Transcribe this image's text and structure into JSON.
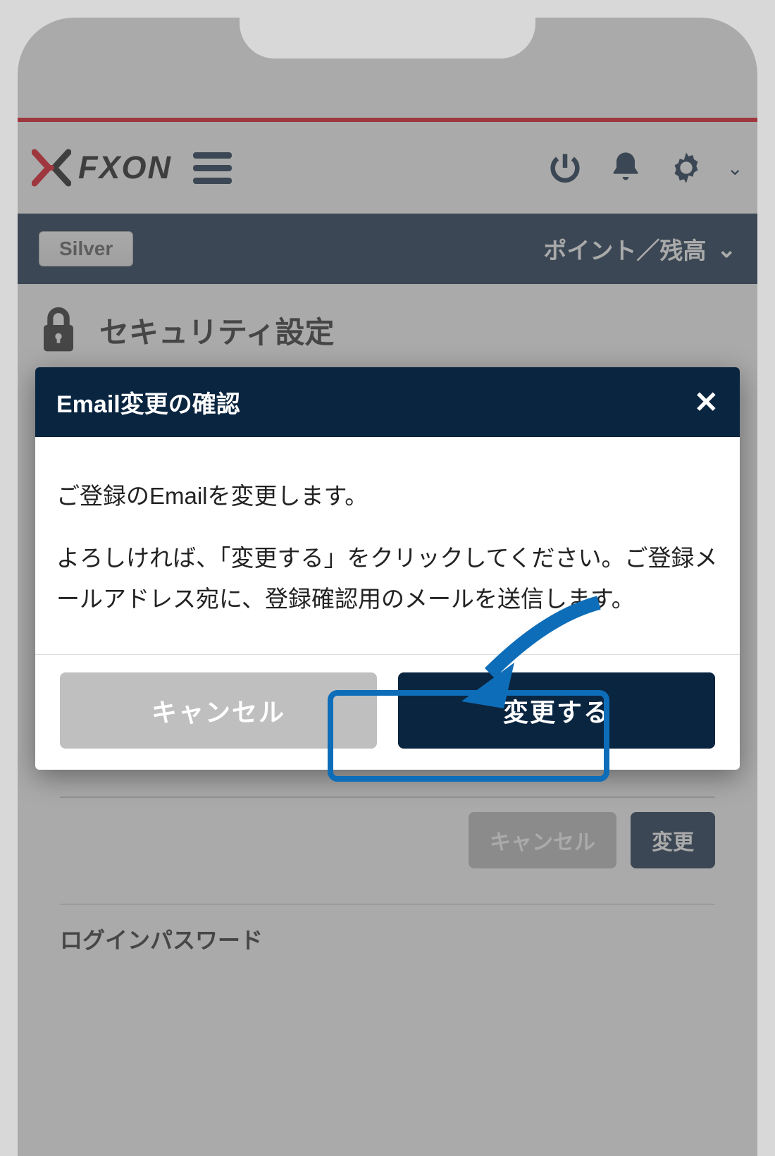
{
  "header": {
    "logo_text": "FXON",
    "badge": "Silver",
    "points_label": "ポイント／残高"
  },
  "page": {
    "title": "セキュリティ設定",
    "section_login_password": "ログインパスワード",
    "bg_cancel": "キャンセル",
    "bg_change": "変更"
  },
  "modal": {
    "title": "Email変更の確認",
    "body_line1": "ご登録のEmailを変更します。",
    "body_line2": "よろしければ、「変更する」をクリックしてください。ご登録メールアドレス宛に、登録確認用のメールを送信します。",
    "cancel": "キャンセル",
    "confirm": "変更する"
  }
}
